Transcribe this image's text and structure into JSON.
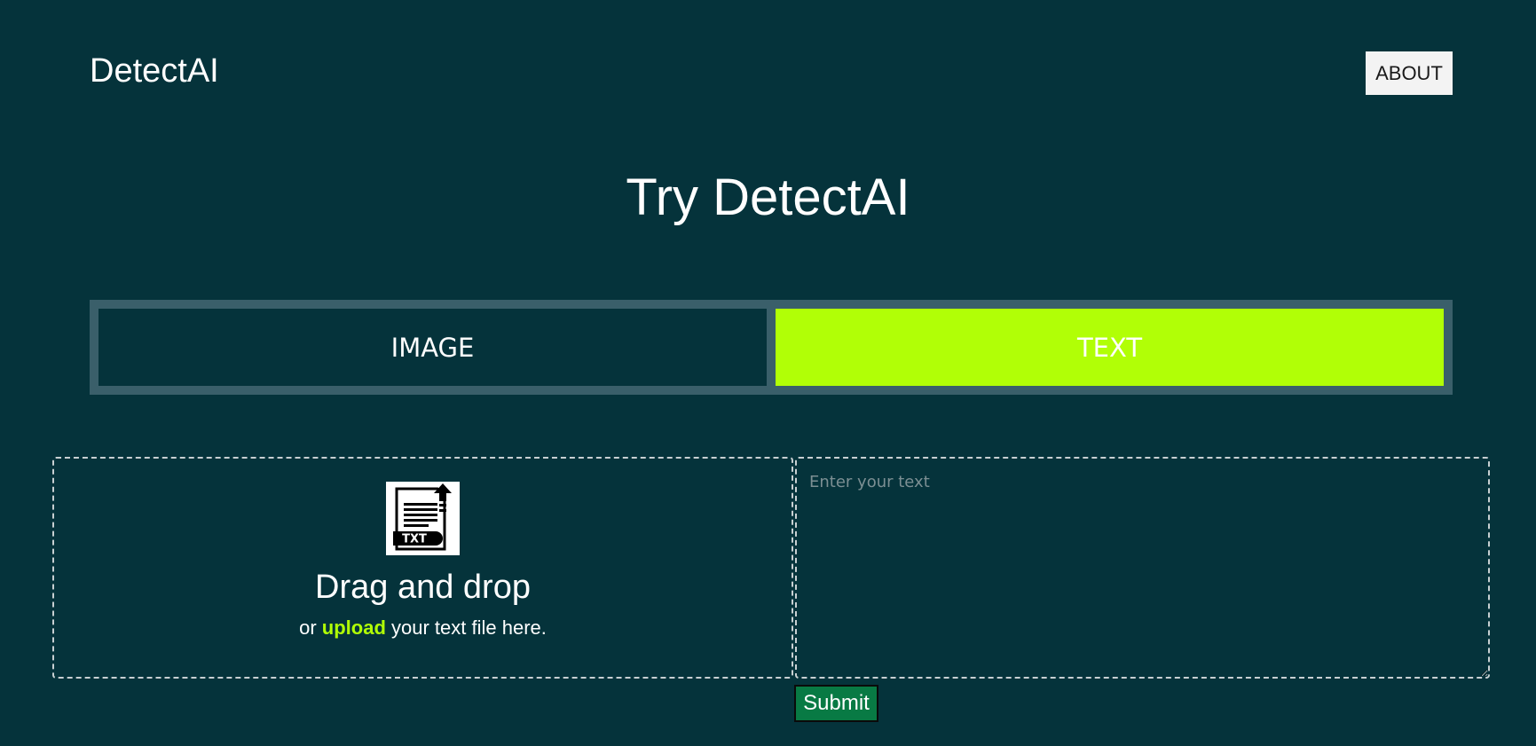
{
  "header": {
    "brand": "DetectAI",
    "about_label": "ABOUT"
  },
  "hero": {
    "title": "Try DetectAI"
  },
  "tabs": [
    {
      "label": "IMAGE",
      "active": false
    },
    {
      "label": "TEXT",
      "active": true
    }
  ],
  "dropzone": {
    "icon": "txt-file-upload-icon",
    "icon_text": "TXT",
    "title": "Drag and drop",
    "sub_prefix": "or",
    "sub_link": "upload",
    "sub_suffix": "your text file here."
  },
  "text_input": {
    "placeholder": "Enter your text",
    "value": ""
  },
  "submit_label": "Submit",
  "colors": {
    "background": "#05333b",
    "accent": "#b1ff06",
    "tab_border": "#3a5f6a",
    "submit": "#087a44"
  }
}
